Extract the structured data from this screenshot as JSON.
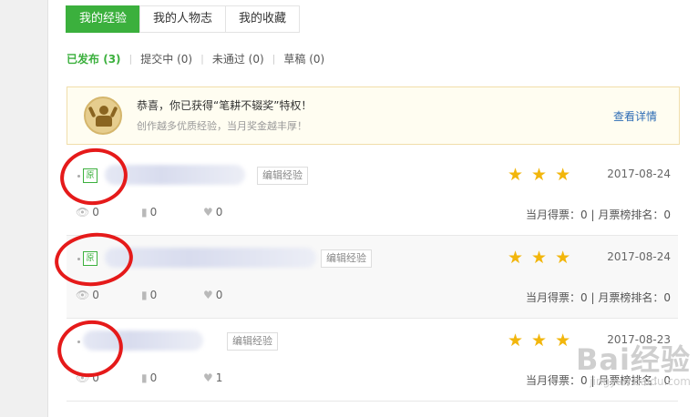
{
  "tabs": [
    {
      "label": "我的经验",
      "active": true
    },
    {
      "label": "我的人物志",
      "active": false
    },
    {
      "label": "我的收藏",
      "active": false
    }
  ],
  "filters": [
    {
      "label": "已发布",
      "count": "(3)",
      "active": true
    },
    {
      "label": "提交中",
      "count": "(0)",
      "active": false
    },
    {
      "label": "未通过",
      "count": "(0)",
      "active": false
    },
    {
      "label": "草稿",
      "count": "(0)",
      "active": false
    }
  ],
  "banner": {
    "title": "恭喜，你已获得“笔耕不辍奖”特权！",
    "subtitle": "创作越多优质经验，当月奖金越丰厚！",
    "link": "查看详情"
  },
  "rows": [
    {
      "tag": "原",
      "edit_label": "编辑经验",
      "date": "2017-08-24",
      "stars": 3,
      "views": "0",
      "votes_stat": "0",
      "likes": "0",
      "monthly": "当月得票：0 | 月票榜排名：0"
    },
    {
      "tag": "原",
      "edit_label": "编辑经验",
      "date": "2017-08-24",
      "stars": 3,
      "views": "0",
      "votes_stat": "0",
      "likes": "0",
      "monthly": "当月得票：0 | 月票榜排名：0"
    },
    {
      "tag": "",
      "edit_label": "编辑经验",
      "date": "2017-08-23",
      "stars": 3,
      "views": "0",
      "votes_stat": "0",
      "likes": "1",
      "monthly": "当月得票：0 | 月票榜排名：0"
    }
  ],
  "watermark": {
    "brand": "Bai经验",
    "url": "jingyan.baidu.com"
  },
  "colors": {
    "accent": "#3bb03d",
    "star": "#f2b60c",
    "link": "#2d6cb5",
    "annotation": "#e51a1a"
  }
}
